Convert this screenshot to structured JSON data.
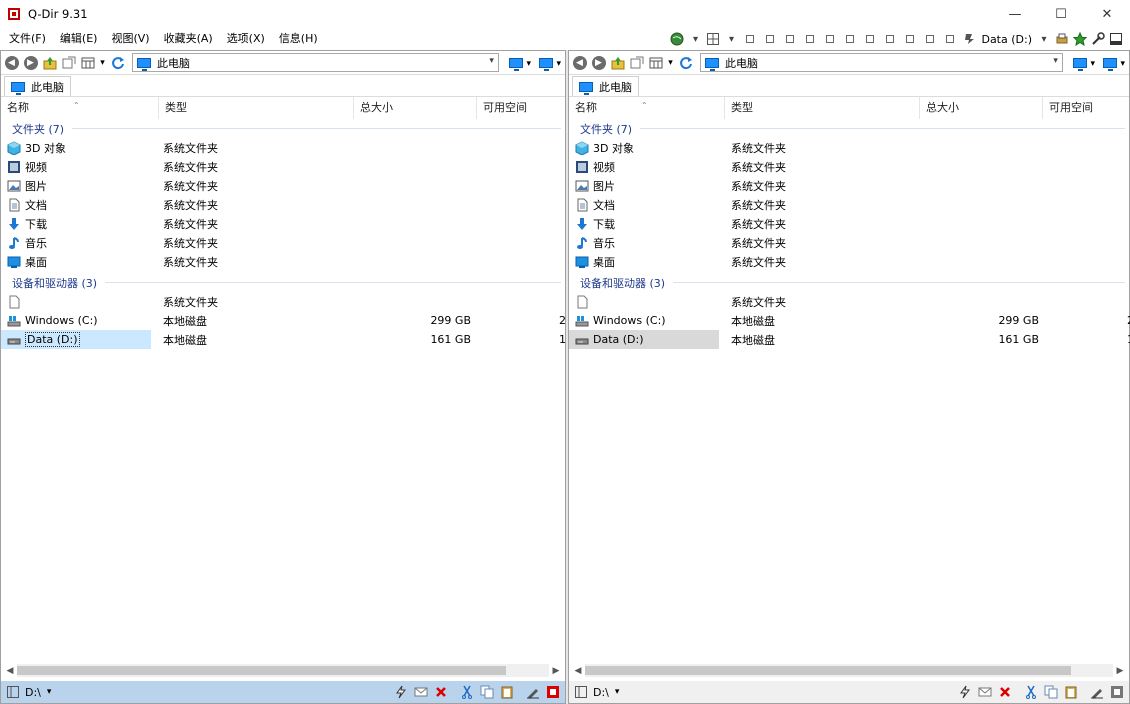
{
  "window": {
    "title": "Q-Dir 9.31",
    "minimize": "—",
    "maximize": "☐",
    "close": "✕"
  },
  "menu": [
    "文件(F)",
    "编辑(E)",
    "视图(V)",
    "收藏夹(A)",
    "选项(X)",
    "信息(H)"
  ],
  "top_toolbar": {
    "drive_label": "Data (D:)"
  },
  "panes": [
    {
      "id": "left",
      "address": "此电脑",
      "tab": "此电脑",
      "columns": [
        "名称",
        "类型",
        "总大小",
        "可用空间"
      ],
      "groups": [
        {
          "title": "文件夹 (7)",
          "items": [
            {
              "name": "3D 对象",
              "type": "系统文件夹",
              "icon": "3d-objects-icon"
            },
            {
              "name": "视频",
              "type": "系统文件夹",
              "icon": "video-icon"
            },
            {
              "name": "图片",
              "type": "系统文件夹",
              "icon": "pictures-icon"
            },
            {
              "name": "文档",
              "type": "系统文件夹",
              "icon": "documents-icon"
            },
            {
              "name": "下载",
              "type": "系统文件夹",
              "icon": "download-icon"
            },
            {
              "name": "音乐",
              "type": "系统文件夹",
              "icon": "music-icon"
            },
            {
              "name": "桌面",
              "type": "系统文件夹",
              "icon": "desktop-icon"
            }
          ]
        },
        {
          "title": "设备和驱动器 (3)",
          "items": [
            {
              "name": "",
              "type": "系统文件夹",
              "icon": "blank-file-icon"
            },
            {
              "name": "Windows (C:)",
              "type": "本地磁盘",
              "size": "299 GB",
              "free": "2",
              "icon": "windows-drive-icon"
            },
            {
              "name": "Data (D:)",
              "type": "本地磁盘",
              "size": "161 GB",
              "free": "1",
              "icon": "drive-icon"
            }
          ]
        }
      ],
      "status": "D:\\"
    },
    {
      "id": "right",
      "address": "此电脑",
      "tab": "此电脑",
      "columns": [
        "名称",
        "类型",
        "总大小",
        "可用空间"
      ],
      "groups": [
        {
          "title": "文件夹 (7)",
          "items": [
            {
              "name": "3D 对象",
              "type": "系统文件夹",
              "icon": "3d-objects-icon"
            },
            {
              "name": "视频",
              "type": "系统文件夹",
              "icon": "video-icon"
            },
            {
              "name": "图片",
              "type": "系统文件夹",
              "icon": "pictures-icon"
            },
            {
              "name": "文档",
              "type": "系统文件夹",
              "icon": "documents-icon"
            },
            {
              "name": "下载",
              "type": "系统文件夹",
              "icon": "download-icon"
            },
            {
              "name": "音乐",
              "type": "系统文件夹",
              "icon": "music-icon"
            },
            {
              "name": "桌面",
              "type": "系统文件夹",
              "icon": "desktop-icon"
            }
          ]
        },
        {
          "title": "设备和驱动器 (3)",
          "items": [
            {
              "name": "",
              "type": "系统文件夹",
              "icon": "blank-file-icon"
            },
            {
              "name": "Windows (C:)",
              "type": "本地磁盘",
              "size": "299 GB",
              "free": "2",
              "icon": "windows-drive-icon"
            },
            {
              "name": "Data (D:)",
              "type": "本地磁盘",
              "size": "161 GB",
              "free": "1",
              "icon": "drive-icon"
            }
          ]
        }
      ],
      "status": "D:\\"
    }
  ]
}
